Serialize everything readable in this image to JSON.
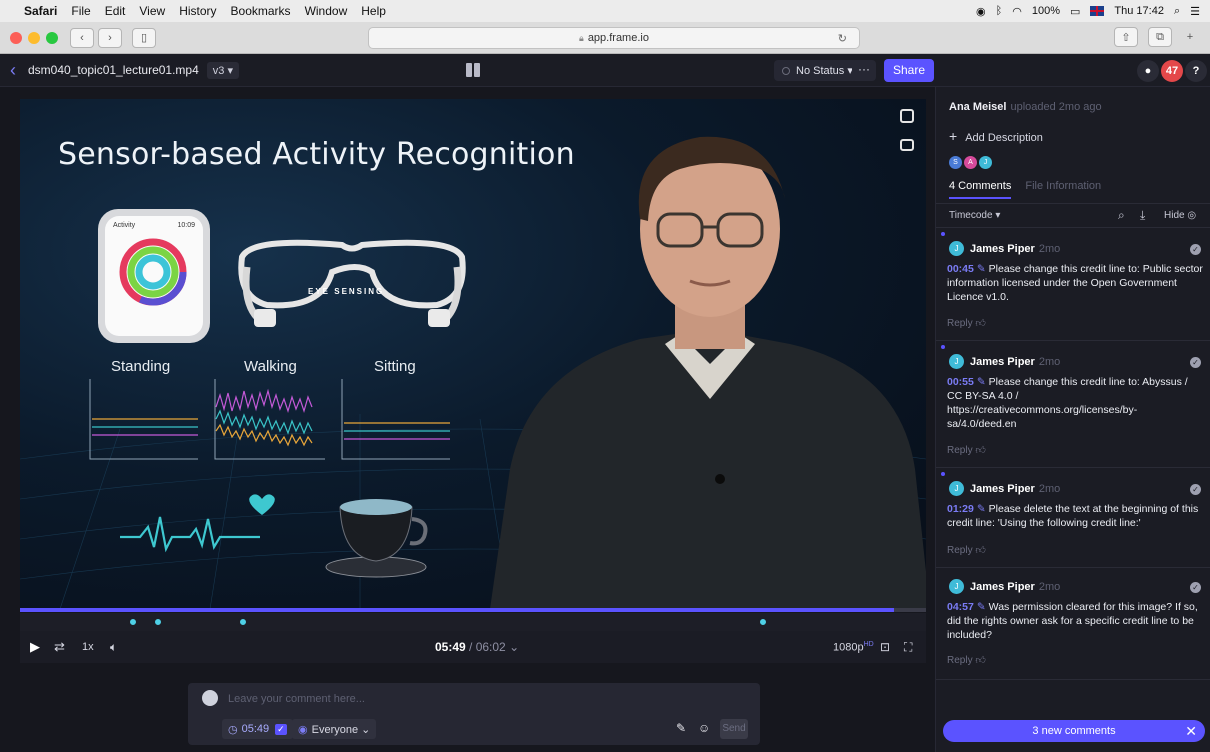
{
  "menubar": {
    "items": [
      "Safari",
      "File",
      "Edit",
      "View",
      "History",
      "Bookmarks",
      "Window",
      "Help"
    ],
    "battery": "100%",
    "clock": "Thu 17:42"
  },
  "browser": {
    "url": "app.frame.io"
  },
  "header": {
    "file_name": "dsm040_topic01_lecture01.mp4",
    "version": "v3 ▾",
    "status": "No Status ▾",
    "more": "···",
    "share": "Share",
    "notifications_count": "47",
    "help": "?"
  },
  "video": {
    "slide_title": "Sensor-based Activity Recognition",
    "watch_activity": "Activity",
    "watch_time": "10:09",
    "glasses_label": "EYE SENSING",
    "activities": [
      "Standing",
      "Walking",
      "Sitting"
    ]
  },
  "player": {
    "progress_fraction": 0.965,
    "speed": "1x",
    "current_time": "05:49",
    "duration": " / 06:02 ⌄",
    "quality": "1080p",
    "quality_badge": "HD",
    "marker_times": [
      "00:45",
      "00:55",
      "01:29",
      "04:57"
    ]
  },
  "composer": {
    "placeholder": "Leave your comment here...",
    "timecode": "05:49",
    "audience": "Everyone ⌄",
    "send": "Send"
  },
  "panel": {
    "uploader_name": "Ana Meisel",
    "uploader_meta": "uploaded 2mo ago",
    "add_description": "Add Description",
    "avatars": [
      "S",
      "A",
      "J"
    ],
    "tab_comments": "4 Comments",
    "tab_file_info": "File Information",
    "sort_label": "Timecode ▾",
    "hide_label": "Hide",
    "reply_label": "Reply",
    "comments": [
      {
        "author": "James Piper",
        "age": "2mo",
        "timecode": "00:45",
        "text": "Please change this credit line to: Public sector information licensed under the Open Government Licence v1.0."
      },
      {
        "author": "James Piper",
        "age": "2mo",
        "timecode": "00:55",
        "text": "Please change this credit line to: Abyssus / CC BY-SA 4.0 / https://creativecommons.org/licenses/by-sa/4.0/deed.en"
      },
      {
        "author": "James Piper",
        "age": "2mo",
        "timecode": "01:29",
        "text": "Please delete the text at the beginning of this credit line: 'Using the following credit line:'"
      },
      {
        "author": "James Piper",
        "age": "2mo",
        "timecode": "04:57",
        "text": "Was permission cleared for this image? If so, did the rights owner ask for a specific credit line to be included?"
      }
    ],
    "new_comments": "3 new comments"
  },
  "colors": {
    "accent": "#5b53ff",
    "marker": "#4ed0e6",
    "panel_bg": "#1b1c24"
  }
}
